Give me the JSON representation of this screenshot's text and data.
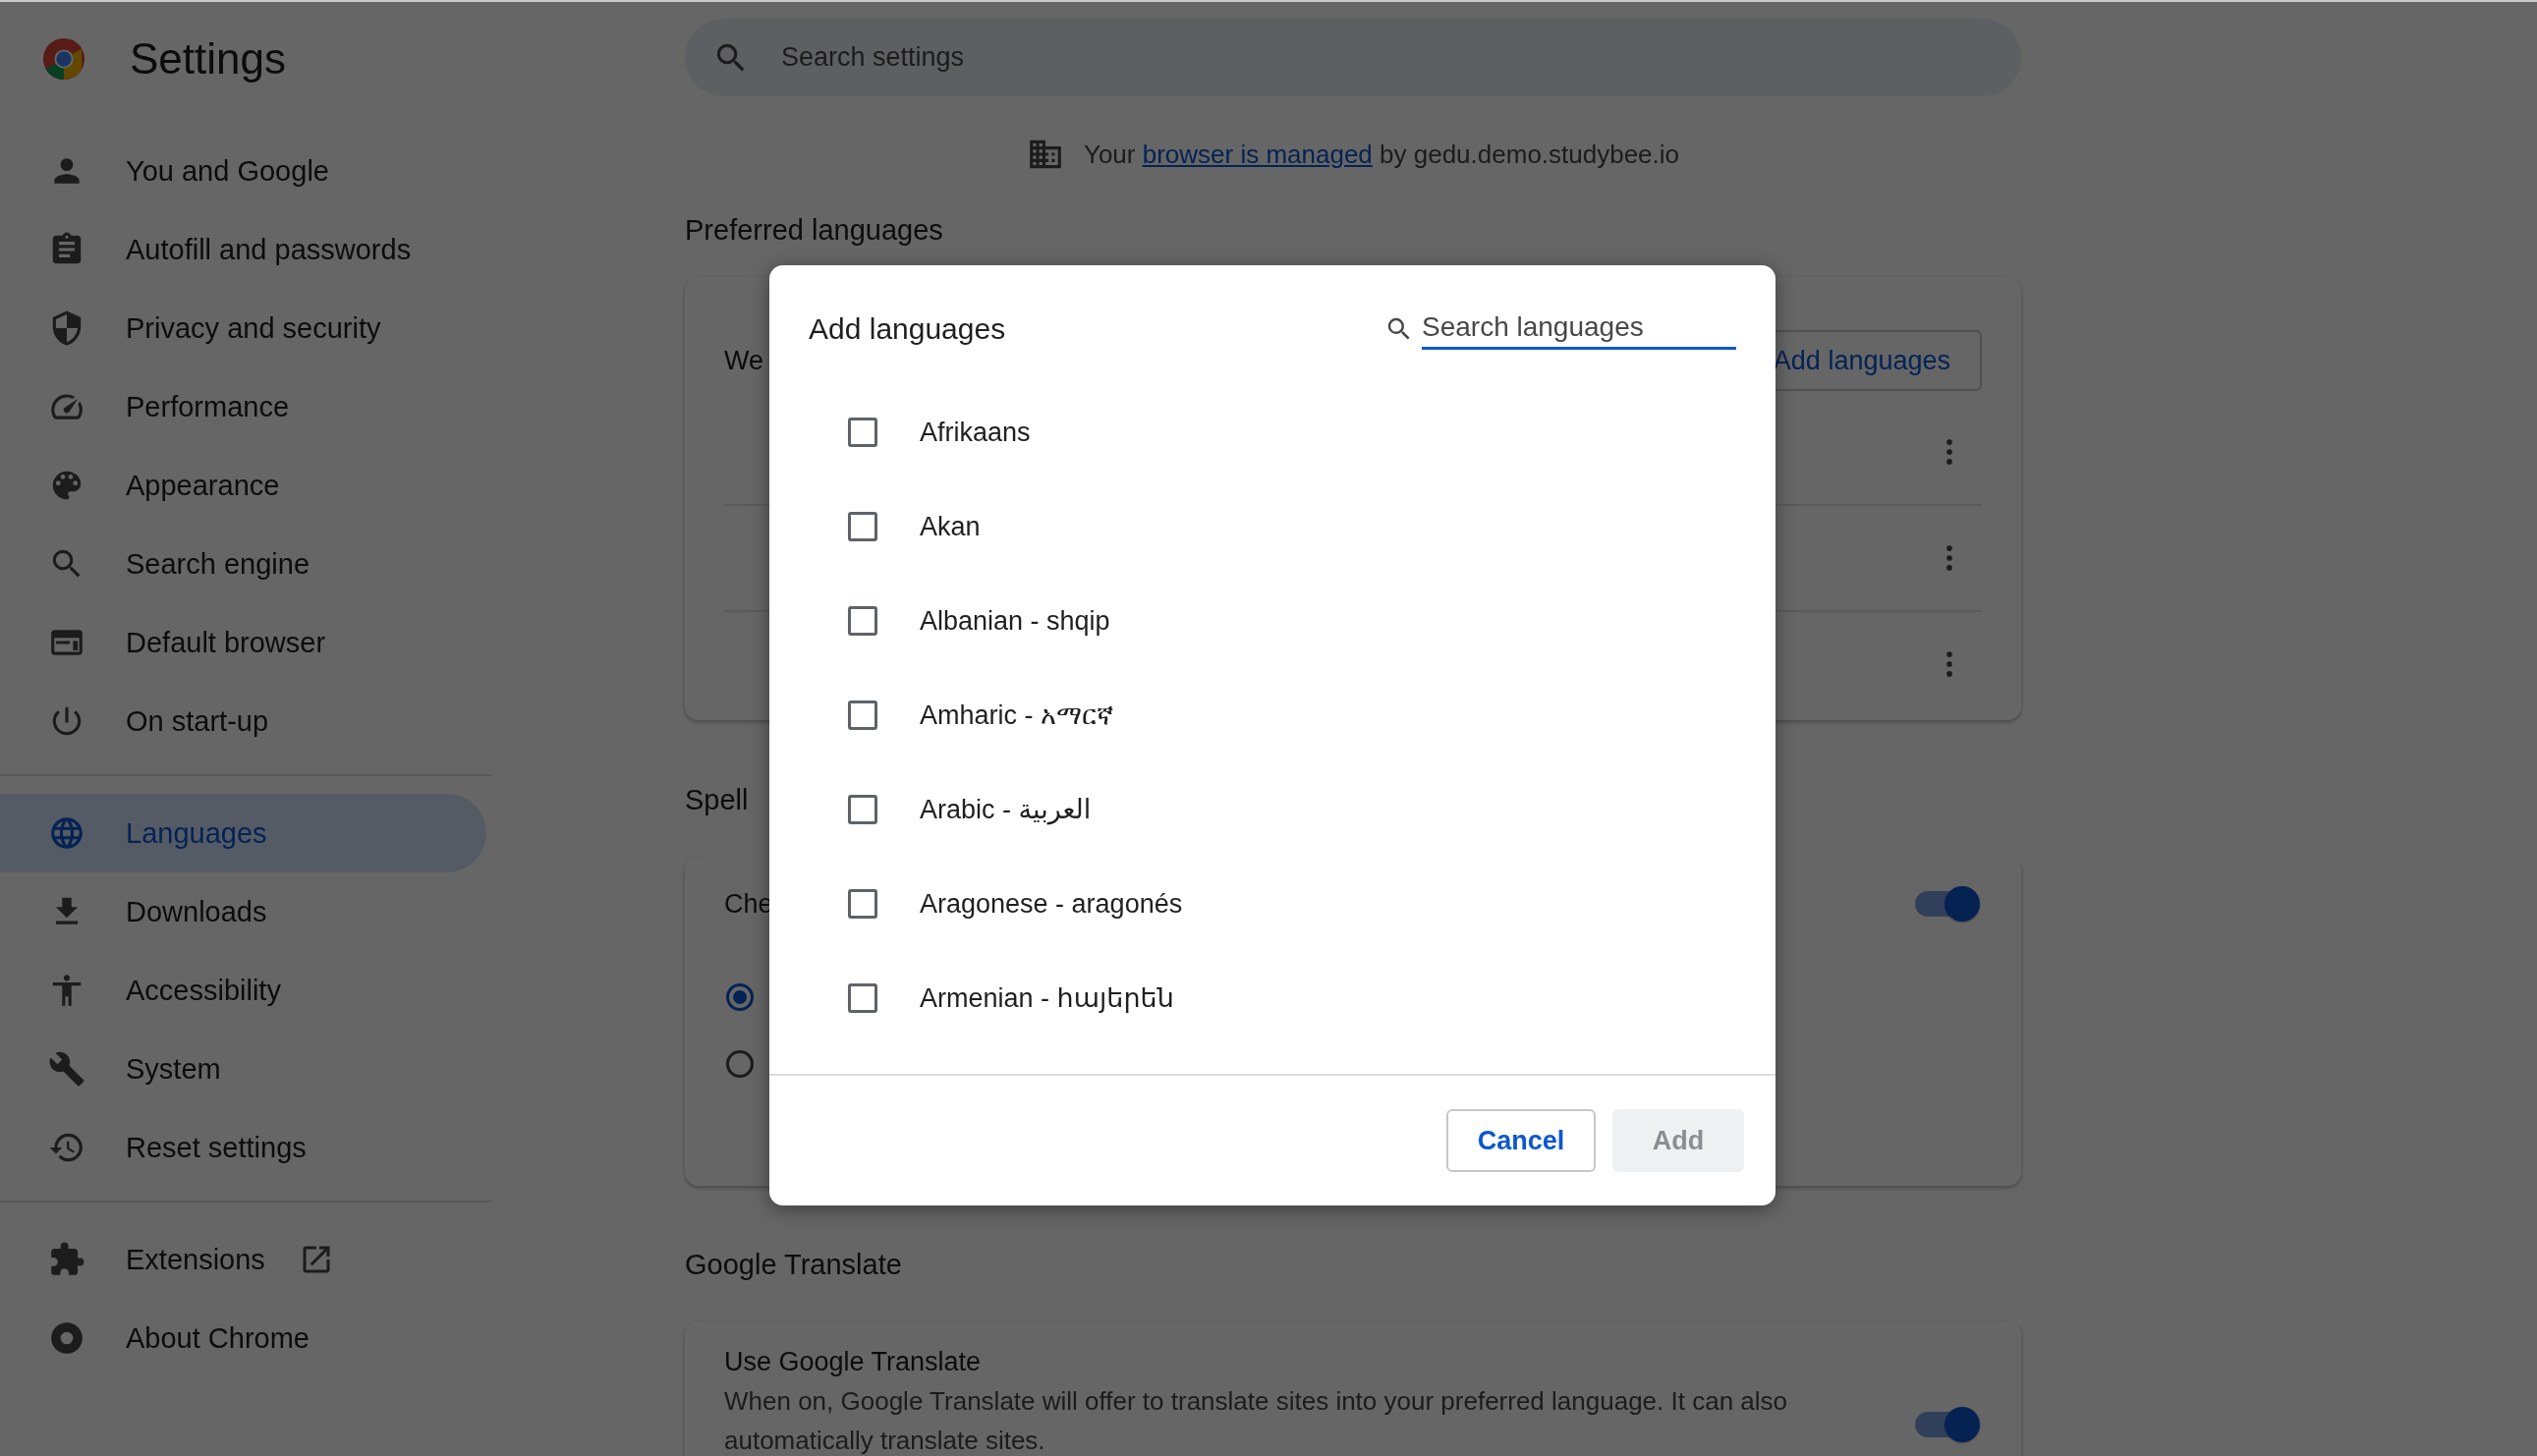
{
  "header": {
    "title": "Settings",
    "search": {
      "placeholder": "Search settings"
    }
  },
  "managed_notice": {
    "before": "Your",
    "link": "browser is managed",
    "after": "by gedu.demo.studybee.io"
  },
  "sidebar": {
    "groups": [
      [
        {
          "label": "You and Google",
          "selected": false,
          "kind": "page"
        },
        {
          "label": "Autofill and passwords",
          "selected": false,
          "kind": "page"
        },
        {
          "label": "Privacy and security",
          "selected": false,
          "kind": "page"
        },
        {
          "label": "Performance",
          "selected": false,
          "kind": "page"
        },
        {
          "label": "Appearance",
          "selected": false,
          "kind": "page"
        },
        {
          "label": "Search engine",
          "selected": false,
          "kind": "page"
        },
        {
          "label": "Default browser",
          "selected": false,
          "kind": "page"
        },
        {
          "label": "On start-up",
          "selected": false,
          "kind": "page"
        }
      ],
      [
        {
          "label": "Languages",
          "selected": true,
          "kind": "page"
        },
        {
          "label": "Downloads",
          "selected": false,
          "kind": "page"
        },
        {
          "label": "Accessibility",
          "selected": false,
          "kind": "page"
        },
        {
          "label": "System",
          "selected": false,
          "kind": "page"
        },
        {
          "label": "Reset settings",
          "selected": false,
          "kind": "page"
        }
      ],
      [
        {
          "label": "Extensions",
          "selected": false,
          "kind": "external_link"
        },
        {
          "label": "About Chrome",
          "selected": false,
          "kind": "page"
        }
      ]
    ]
  },
  "preferred_languages": {
    "heading": "Preferred languages",
    "label": "We",
    "add_button": "Add languages"
  },
  "spell_check": {
    "heading": "Spell",
    "label": "Che",
    "toggle_on": true,
    "radios": [
      {
        "selected": true
      },
      {
        "selected": false
      }
    ]
  },
  "google_translate": {
    "heading": "Google Translate",
    "title": "Use Google Translate",
    "description": "When on, Google Translate will offer to translate sites into your preferred language. It can also automatically translate sites.",
    "toggle_on": true
  },
  "dialog": {
    "title": "Add languages",
    "search": {
      "placeholder": "Search languages"
    },
    "languages": [
      {
        "label": "Afrikaans",
        "checked": false
      },
      {
        "label": "Akan",
        "checked": false
      },
      {
        "label": "Albanian - shqip",
        "checked": false
      },
      {
        "label": "Amharic - አማርኛ",
        "checked": false
      },
      {
        "label": "Arabic - العربية",
        "checked": false
      },
      {
        "label": "Aragonese - aragonés",
        "checked": false
      },
      {
        "label": "Armenian - հայերեն",
        "checked": false
      }
    ],
    "buttons": {
      "cancel": "Cancel",
      "add": "Add"
    },
    "add_disabled": true
  }
}
